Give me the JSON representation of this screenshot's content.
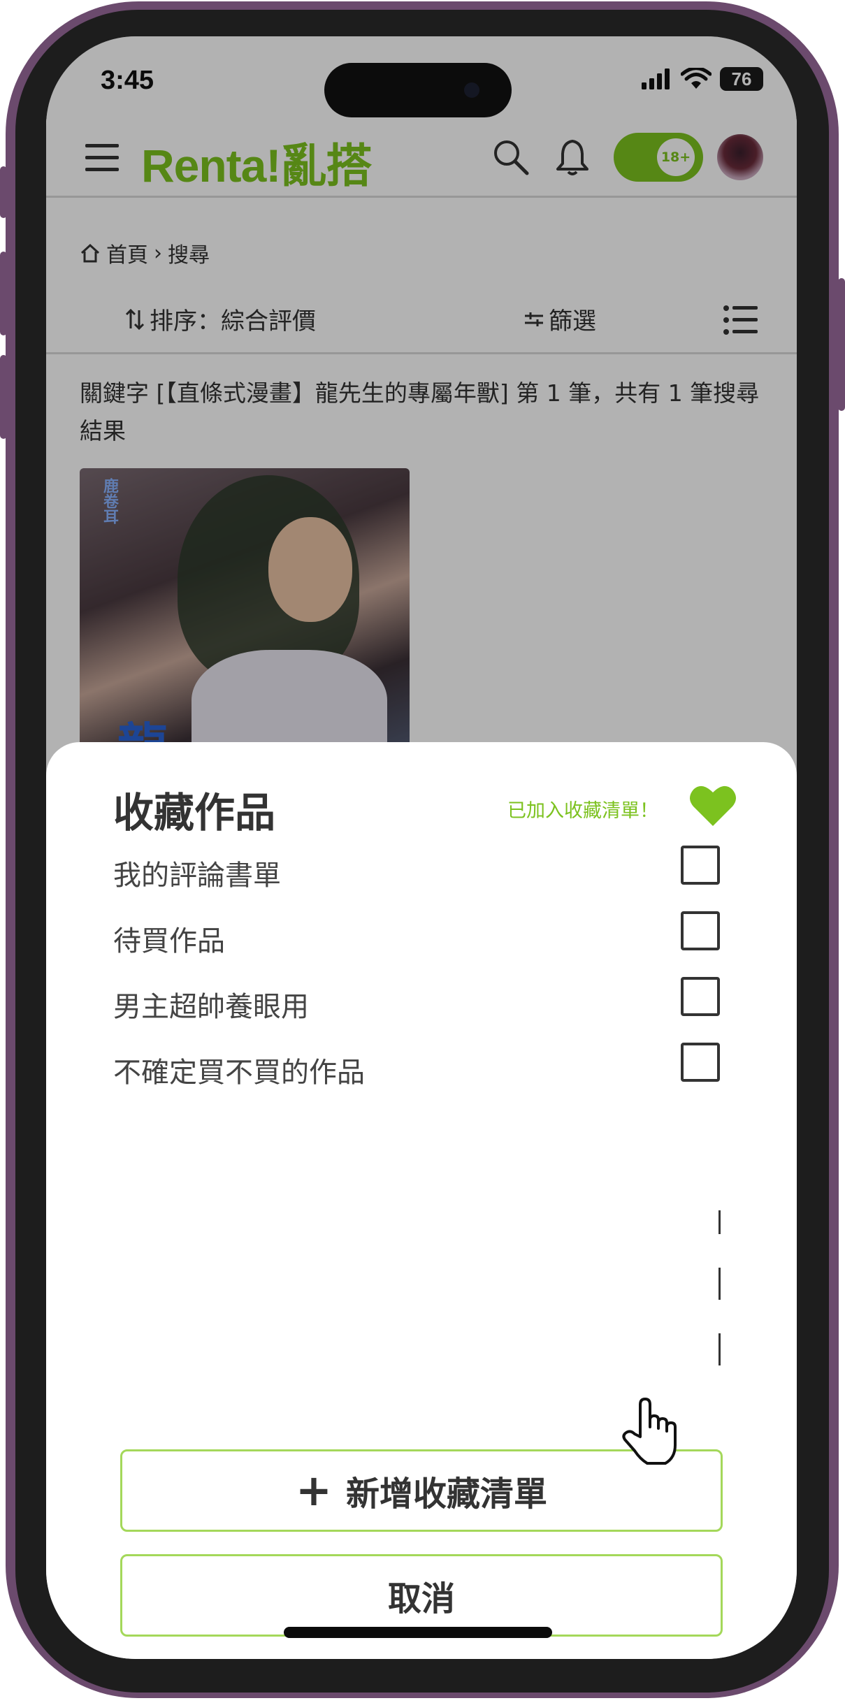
{
  "status_bar": {
    "time": "3:45",
    "battery": "76"
  },
  "header": {
    "logo": "Renta!亂搭",
    "age_badge": "18+",
    "search_icon": "search-icon",
    "bell_icon": "bell-icon",
    "menu_icon": "hamburger-icon"
  },
  "breadcrumb": {
    "home": "首頁",
    "separator": "›",
    "current": "搜尋"
  },
  "sortbar": {
    "sort_label": "排序：綜合評價",
    "filter_label": "篩選"
  },
  "results": {
    "summary": "關鍵字 [【直條式漫畫】龍先生的專屬年獸] 第 1 筆，共有 1 筆搜尋結果",
    "cover_badge": "鹿卷耳",
    "cover_title_char": "龍"
  },
  "sheet": {
    "title": "收藏作品",
    "added_message": "已加入收藏清單！",
    "accent_color": "#7cc21f",
    "lists": [
      {
        "label": "我的評論書單",
        "checked": false
      },
      {
        "label": "待買作品",
        "checked": false
      },
      {
        "label": "男主超帥養眼用",
        "checked": false
      },
      {
        "label": "不確定買不買的作品",
        "checked": false
      }
    ],
    "add_list_button": "新增收藏清單",
    "add_icon": "+",
    "cancel_button": "取消"
  }
}
